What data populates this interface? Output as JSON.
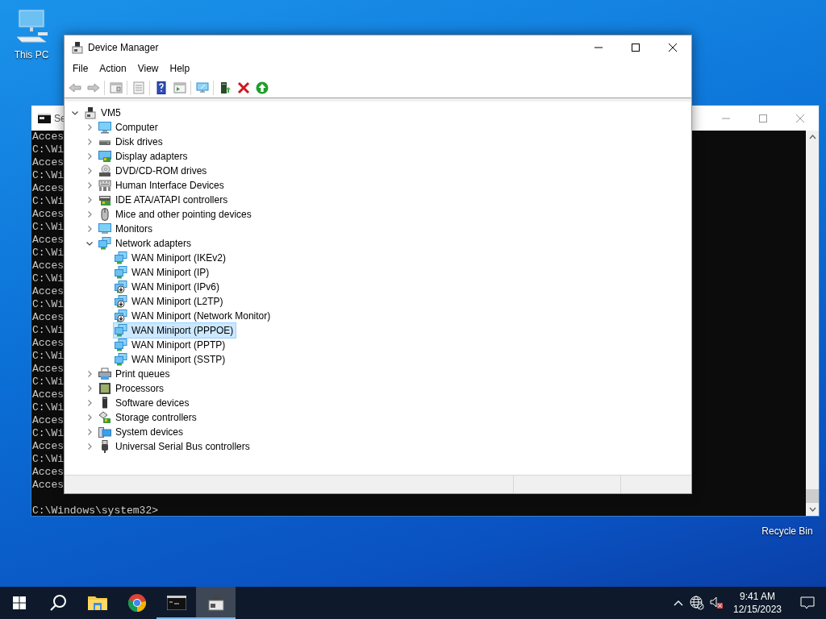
{
  "desktop_icons": [
    {
      "label": "This PC"
    },
    {
      "label": "Recycle Bin"
    }
  ],
  "console": {
    "title": "Se",
    "lines": [
      "Acces",
      "C:\\Wi",
      "Acces",
      "C:\\Wi",
      "Acces",
      "C:\\Wi",
      "Acces",
      "C:\\Wi",
      "Acces",
      "C:\\Wi",
      "Acces",
      "C:\\Wi",
      "Acces",
      "C:\\Wi",
      "Acces",
      "C:\\Wi",
      "Acces",
      "C:\\Wi",
      "Acces",
      "C:\\Wi",
      "Acces",
      "C:\\Wi",
      "Acces",
      "C:\\Wi",
      "Acces",
      "C:\\Wi",
      "Acces",
      "Acces"
    ],
    "prompt": "C:\\Windows\\system32>"
  },
  "device_manager": {
    "title": "Device Manager",
    "menu": [
      "File",
      "Action",
      "View",
      "Help"
    ],
    "tree": {
      "label": "VM5",
      "kind": "root",
      "expanded": true,
      "selected": false,
      "children": [
        {
          "label": "Computer",
          "kind": "computer",
          "expanded": false,
          "selected": false
        },
        {
          "label": "Disk drives",
          "kind": "disk",
          "expanded": false,
          "selected": false
        },
        {
          "label": "Display adapters",
          "kind": "display",
          "expanded": false,
          "selected": false
        },
        {
          "label": "DVD/CD-ROM drives",
          "kind": "dvd",
          "expanded": false,
          "selected": false
        },
        {
          "label": "Human Interface Devices",
          "kind": "hid",
          "expanded": false,
          "selected": false
        },
        {
          "label": "IDE ATA/ATAPI controllers",
          "kind": "ide",
          "expanded": false,
          "selected": false
        },
        {
          "label": "Mice and other pointing devices",
          "kind": "mouse",
          "expanded": false,
          "selected": false
        },
        {
          "label": "Monitors",
          "kind": "monitor",
          "expanded": false,
          "selected": false
        },
        {
          "label": "Network adapters",
          "kind": "network",
          "expanded": true,
          "selected": false,
          "children": [
            {
              "label": "WAN Miniport (IKEv2)",
              "kind": "network",
              "disabled": false,
              "selected": false
            },
            {
              "label": "WAN Miniport (IP)",
              "kind": "network",
              "disabled": false,
              "selected": false
            },
            {
              "label": "WAN Miniport (IPv6)",
              "kind": "network",
              "disabled": true,
              "selected": false
            },
            {
              "label": "WAN Miniport (L2TP)",
              "kind": "network",
              "disabled": true,
              "selected": false
            },
            {
              "label": "WAN Miniport (Network Monitor)",
              "kind": "network",
              "disabled": true,
              "selected": false
            },
            {
              "label": "WAN Miniport (PPPOE)",
              "kind": "network",
              "disabled": false,
              "selected": true
            },
            {
              "label": "WAN Miniport (PPTP)",
              "kind": "network",
              "disabled": false,
              "selected": false
            },
            {
              "label": "WAN Miniport (SSTP)",
              "kind": "network",
              "disabled": false,
              "selected": false
            }
          ]
        },
        {
          "label": "Print queues",
          "kind": "printer",
          "expanded": false,
          "selected": false
        },
        {
          "label": "Processors",
          "kind": "cpu",
          "expanded": false,
          "selected": false
        },
        {
          "label": "Software devices",
          "kind": "software",
          "expanded": false,
          "selected": false
        },
        {
          "label": "Storage controllers",
          "kind": "storage",
          "expanded": false,
          "selected": false
        },
        {
          "label": "System devices",
          "kind": "system",
          "expanded": false,
          "selected": false
        },
        {
          "label": "Universal Serial Bus controllers",
          "kind": "usb",
          "expanded": false,
          "selected": false
        }
      ]
    }
  },
  "taskbar": {
    "apps": [
      {
        "kind": "start",
        "open": false,
        "active": false
      },
      {
        "kind": "search",
        "open": false,
        "active": false
      },
      {
        "kind": "explorer",
        "open": false,
        "active": false
      },
      {
        "kind": "chrome",
        "open": false,
        "active": false
      },
      {
        "kind": "console",
        "open": true,
        "active": false
      },
      {
        "kind": "devmgr",
        "open": true,
        "active": true
      }
    ],
    "time": "9:41 AM",
    "date": "12/15/2023"
  }
}
